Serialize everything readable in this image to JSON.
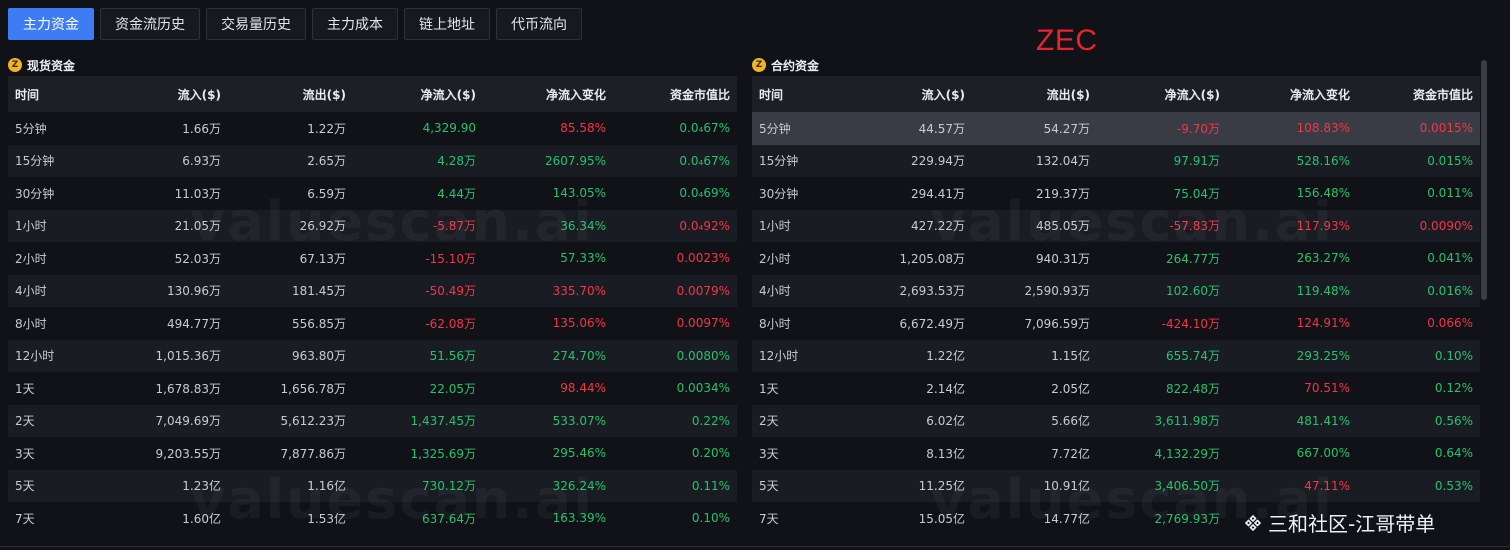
{
  "tabs": [
    {
      "label": "主力资金",
      "active": true
    },
    {
      "label": "资金流历史",
      "active": false
    },
    {
      "label": "交易量历史",
      "active": false
    },
    {
      "label": "主力成本",
      "active": false
    },
    {
      "label": "链上地址",
      "active": false
    },
    {
      "label": "代币流向",
      "active": false
    }
  ],
  "coin": "ZEC",
  "watermark": "valuescan.ai",
  "footer": {
    "text": "三和社区-江哥带单",
    "icon": "binance-diamond-icon"
  },
  "colors": {
    "accent": "#3e7cf4",
    "positive": "#27c26c",
    "negative": "#f23645",
    "badge": "#f0b429"
  },
  "spot": {
    "badge": "Z",
    "title": "现货资金",
    "columns": [
      "时间",
      "流入($)",
      "流出($)",
      "净流入($)",
      "净流入变化",
      "资金市值比"
    ],
    "rows": [
      {
        "time": "5分钟",
        "inflow": "1.66万",
        "outflow": "1.22万",
        "net": "4,329.90",
        "net_sign": "pos",
        "change": "85.58%",
        "change_sign": "neg",
        "ratio": "0.0₄67%",
        "ratio_sign": "pos"
      },
      {
        "time": "15分钟",
        "inflow": "6.93万",
        "outflow": "2.65万",
        "net": "4.28万",
        "net_sign": "pos",
        "change": "2607.95%",
        "change_sign": "pos",
        "ratio": "0.0₄67%",
        "ratio_sign": "pos"
      },
      {
        "time": "30分钟",
        "inflow": "11.03万",
        "outflow": "6.59万",
        "net": "4.44万",
        "net_sign": "pos",
        "change": "143.05%",
        "change_sign": "pos",
        "ratio": "0.0₄69%",
        "ratio_sign": "pos"
      },
      {
        "time": "1小时",
        "inflow": "21.05万",
        "outflow": "26.92万",
        "net": "-5.87万",
        "net_sign": "neg",
        "change": "36.34%",
        "change_sign": "pos",
        "ratio": "0.0₄92%",
        "ratio_sign": "neg"
      },
      {
        "time": "2小时",
        "inflow": "52.03万",
        "outflow": "67.13万",
        "net": "-15.10万",
        "net_sign": "neg",
        "change": "57.33%",
        "change_sign": "pos",
        "ratio": "0.0023%",
        "ratio_sign": "neg"
      },
      {
        "time": "4小时",
        "inflow": "130.96万",
        "outflow": "181.45万",
        "net": "-50.49万",
        "net_sign": "neg",
        "change": "335.70%",
        "change_sign": "neg",
        "ratio": "0.0079%",
        "ratio_sign": "neg"
      },
      {
        "time": "8小时",
        "inflow": "494.77万",
        "outflow": "556.85万",
        "net": "-62.08万",
        "net_sign": "neg",
        "change": "135.06%",
        "change_sign": "neg",
        "ratio": "0.0097%",
        "ratio_sign": "neg"
      },
      {
        "time": "12小时",
        "inflow": "1,015.36万",
        "outflow": "963.80万",
        "net": "51.56万",
        "net_sign": "pos",
        "change": "274.70%",
        "change_sign": "pos",
        "ratio": "0.0080%",
        "ratio_sign": "pos"
      },
      {
        "time": "1天",
        "inflow": "1,678.83万",
        "outflow": "1,656.78万",
        "net": "22.05万",
        "net_sign": "pos",
        "change": "98.44%",
        "change_sign": "neg",
        "ratio": "0.0034%",
        "ratio_sign": "pos"
      },
      {
        "time": "2天",
        "inflow": "7,049.69万",
        "outflow": "5,612.23万",
        "net": "1,437.45万",
        "net_sign": "pos",
        "change": "533.07%",
        "change_sign": "pos",
        "ratio": "0.22%",
        "ratio_sign": "pos"
      },
      {
        "time": "3天",
        "inflow": "9,203.55万",
        "outflow": "7,877.86万",
        "net": "1,325.69万",
        "net_sign": "pos",
        "change": "295.46%",
        "change_sign": "pos",
        "ratio": "0.20%",
        "ratio_sign": "pos"
      },
      {
        "time": "5天",
        "inflow": "1.23亿",
        "outflow": "1.16亿",
        "net": "730.12万",
        "net_sign": "pos",
        "change": "326.24%",
        "change_sign": "pos",
        "ratio": "0.11%",
        "ratio_sign": "pos"
      },
      {
        "time": "7天",
        "inflow": "1.60亿",
        "outflow": "1.53亿",
        "net": "637.64万",
        "net_sign": "pos",
        "change": "163.39%",
        "change_sign": "pos",
        "ratio": "0.10%",
        "ratio_sign": "pos"
      }
    ]
  },
  "contract": {
    "badge": "Z",
    "title": "合约资金",
    "columns": [
      "时间",
      "流入($)",
      "流出($)",
      "净流入($)",
      "净流入变化",
      "资金市值比"
    ],
    "rows": [
      {
        "time": "5分钟",
        "inflow": "44.57万",
        "outflow": "54.27万",
        "net": "-9.70万",
        "net_sign": "neg",
        "change": "108.83%",
        "change_sign": "neg",
        "ratio": "0.0015%",
        "ratio_sign": "neg",
        "highlight": true
      },
      {
        "time": "15分钟",
        "inflow": "229.94万",
        "outflow": "132.04万",
        "net": "97.91万",
        "net_sign": "pos",
        "change": "528.16%",
        "change_sign": "pos",
        "ratio": "0.015%",
        "ratio_sign": "pos"
      },
      {
        "time": "30分钟",
        "inflow": "294.41万",
        "outflow": "219.37万",
        "net": "75.04万",
        "net_sign": "pos",
        "change": "156.48%",
        "change_sign": "pos",
        "ratio": "0.011%",
        "ratio_sign": "pos"
      },
      {
        "time": "1小时",
        "inflow": "427.22万",
        "outflow": "485.05万",
        "net": "-57.83万",
        "net_sign": "neg",
        "change": "117.93%",
        "change_sign": "neg",
        "ratio": "0.0090%",
        "ratio_sign": "neg"
      },
      {
        "time": "2小时",
        "inflow": "1,205.08万",
        "outflow": "940.31万",
        "net": "264.77万",
        "net_sign": "pos",
        "change": "263.27%",
        "change_sign": "pos",
        "ratio": "0.041%",
        "ratio_sign": "pos"
      },
      {
        "time": "4小时",
        "inflow": "2,693.53万",
        "outflow": "2,590.93万",
        "net": "102.60万",
        "net_sign": "pos",
        "change": "119.48%",
        "change_sign": "pos",
        "ratio": "0.016%",
        "ratio_sign": "pos"
      },
      {
        "time": "8小时",
        "inflow": "6,672.49万",
        "outflow": "7,096.59万",
        "net": "-424.10万",
        "net_sign": "neg",
        "change": "124.91%",
        "change_sign": "neg",
        "ratio": "0.066%",
        "ratio_sign": "neg"
      },
      {
        "time": "12小时",
        "inflow": "1.22亿",
        "outflow": "1.15亿",
        "net": "655.74万",
        "net_sign": "pos",
        "change": "293.25%",
        "change_sign": "pos",
        "ratio": "0.10%",
        "ratio_sign": "pos"
      },
      {
        "time": "1天",
        "inflow": "2.14亿",
        "outflow": "2.05亿",
        "net": "822.48万",
        "net_sign": "pos",
        "change": "70.51%",
        "change_sign": "neg",
        "ratio": "0.12%",
        "ratio_sign": "pos"
      },
      {
        "time": "2天",
        "inflow": "6.02亿",
        "outflow": "5.66亿",
        "net": "3,611.98万",
        "net_sign": "pos",
        "change": "481.41%",
        "change_sign": "pos",
        "ratio": "0.56%",
        "ratio_sign": "pos"
      },
      {
        "time": "3天",
        "inflow": "8.13亿",
        "outflow": "7.72亿",
        "net": "4,132.29万",
        "net_sign": "pos",
        "change": "667.00%",
        "change_sign": "pos",
        "ratio": "0.64%",
        "ratio_sign": "pos"
      },
      {
        "time": "5天",
        "inflow": "11.25亿",
        "outflow": "10.91亿",
        "net": "3,406.50万",
        "net_sign": "pos",
        "change": "47.11%",
        "change_sign": "neg",
        "ratio": "0.53%",
        "ratio_sign": "pos"
      },
      {
        "time": "7天",
        "inflow": "15.05亿",
        "outflow": "14.77亿",
        "net": "2,769.93万",
        "net_sign": "pos",
        "change": "",
        "change_sign": "neg",
        "ratio": "",
        "ratio_sign": "pos"
      }
    ]
  }
}
